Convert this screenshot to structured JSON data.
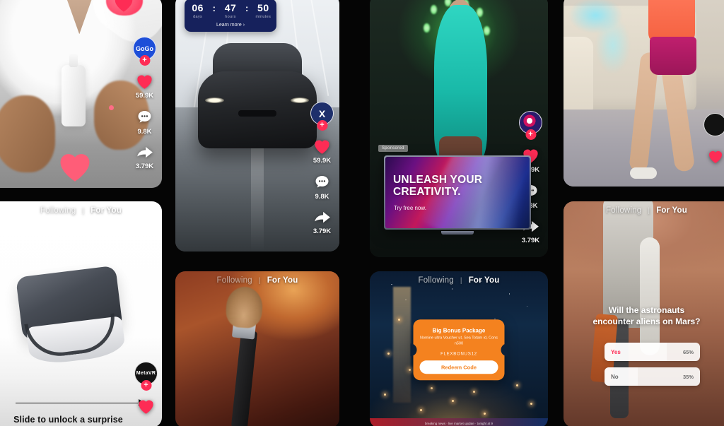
{
  "app": {
    "background": "#050505",
    "accent": "#fe2c55"
  },
  "feedbar": {
    "following": "Following",
    "separator": "|",
    "for_you": "For You"
  },
  "cards": [
    {
      "id": "card-tshirt-bottle",
      "rail": {
        "avatar_label": "GoGo",
        "follow_plus": "+",
        "like_count": "59.9K",
        "comment_count": "9.8K",
        "share_count": "3.79K"
      }
    },
    {
      "id": "card-car-countdown",
      "countdown": {
        "days_value": "06",
        "hours_value": "47",
        "minutes_value": "50",
        "days_label": "days",
        "hours_label": "hours",
        "minutes_label": "minutes",
        "colon": ":",
        "cta": "Learn more ›"
      },
      "rail": {
        "avatar_label": "X",
        "follow_plus": "+",
        "like_count": "59.9K",
        "comment_count": "9.8K",
        "share_count": "3.79K"
      }
    },
    {
      "id": "card-concert-tv-ad",
      "sponsored_badge": "Sponsored",
      "ad": {
        "headline_line1": "UNLEASH YOUR",
        "headline_line2": "CREATIVITY.",
        "subtext": "Try free now."
      },
      "rail": {
        "avatar_label": "",
        "follow_plus": "+",
        "like_count": "59.9K",
        "comment_count": "9.8K",
        "share_count": "3.79K"
      }
    },
    {
      "id": "card-living-room-dance"
    },
    {
      "id": "card-vr-slide-unlock",
      "slide_text": "Slide to unlock a surprise",
      "rail": {
        "avatar_label": "MetaVR",
        "follow_plus": "+"
      }
    },
    {
      "id": "card-makeup-brush"
    },
    {
      "id": "card-city-bonus",
      "bonus": {
        "title": "Big Bonus Package",
        "subtitle": "Nomine ultra Voucher ut, Sea Totam id, Cons n500",
        "code": "FLEXBONUS12",
        "button_label": "Redeem Code"
      },
      "ticker": "breaking news  ·  live market update  ·  tonight at 9"
    },
    {
      "id": "card-mars-poll",
      "poll": {
        "question_line1": "Will the astronauts",
        "question_line2": "encounter aliens on Mars?",
        "options": [
          {
            "label": "Yes",
            "percent": "65%",
            "value": 65
          },
          {
            "label": "No",
            "percent": "35%",
            "value": 35
          }
        ]
      }
    }
  ]
}
